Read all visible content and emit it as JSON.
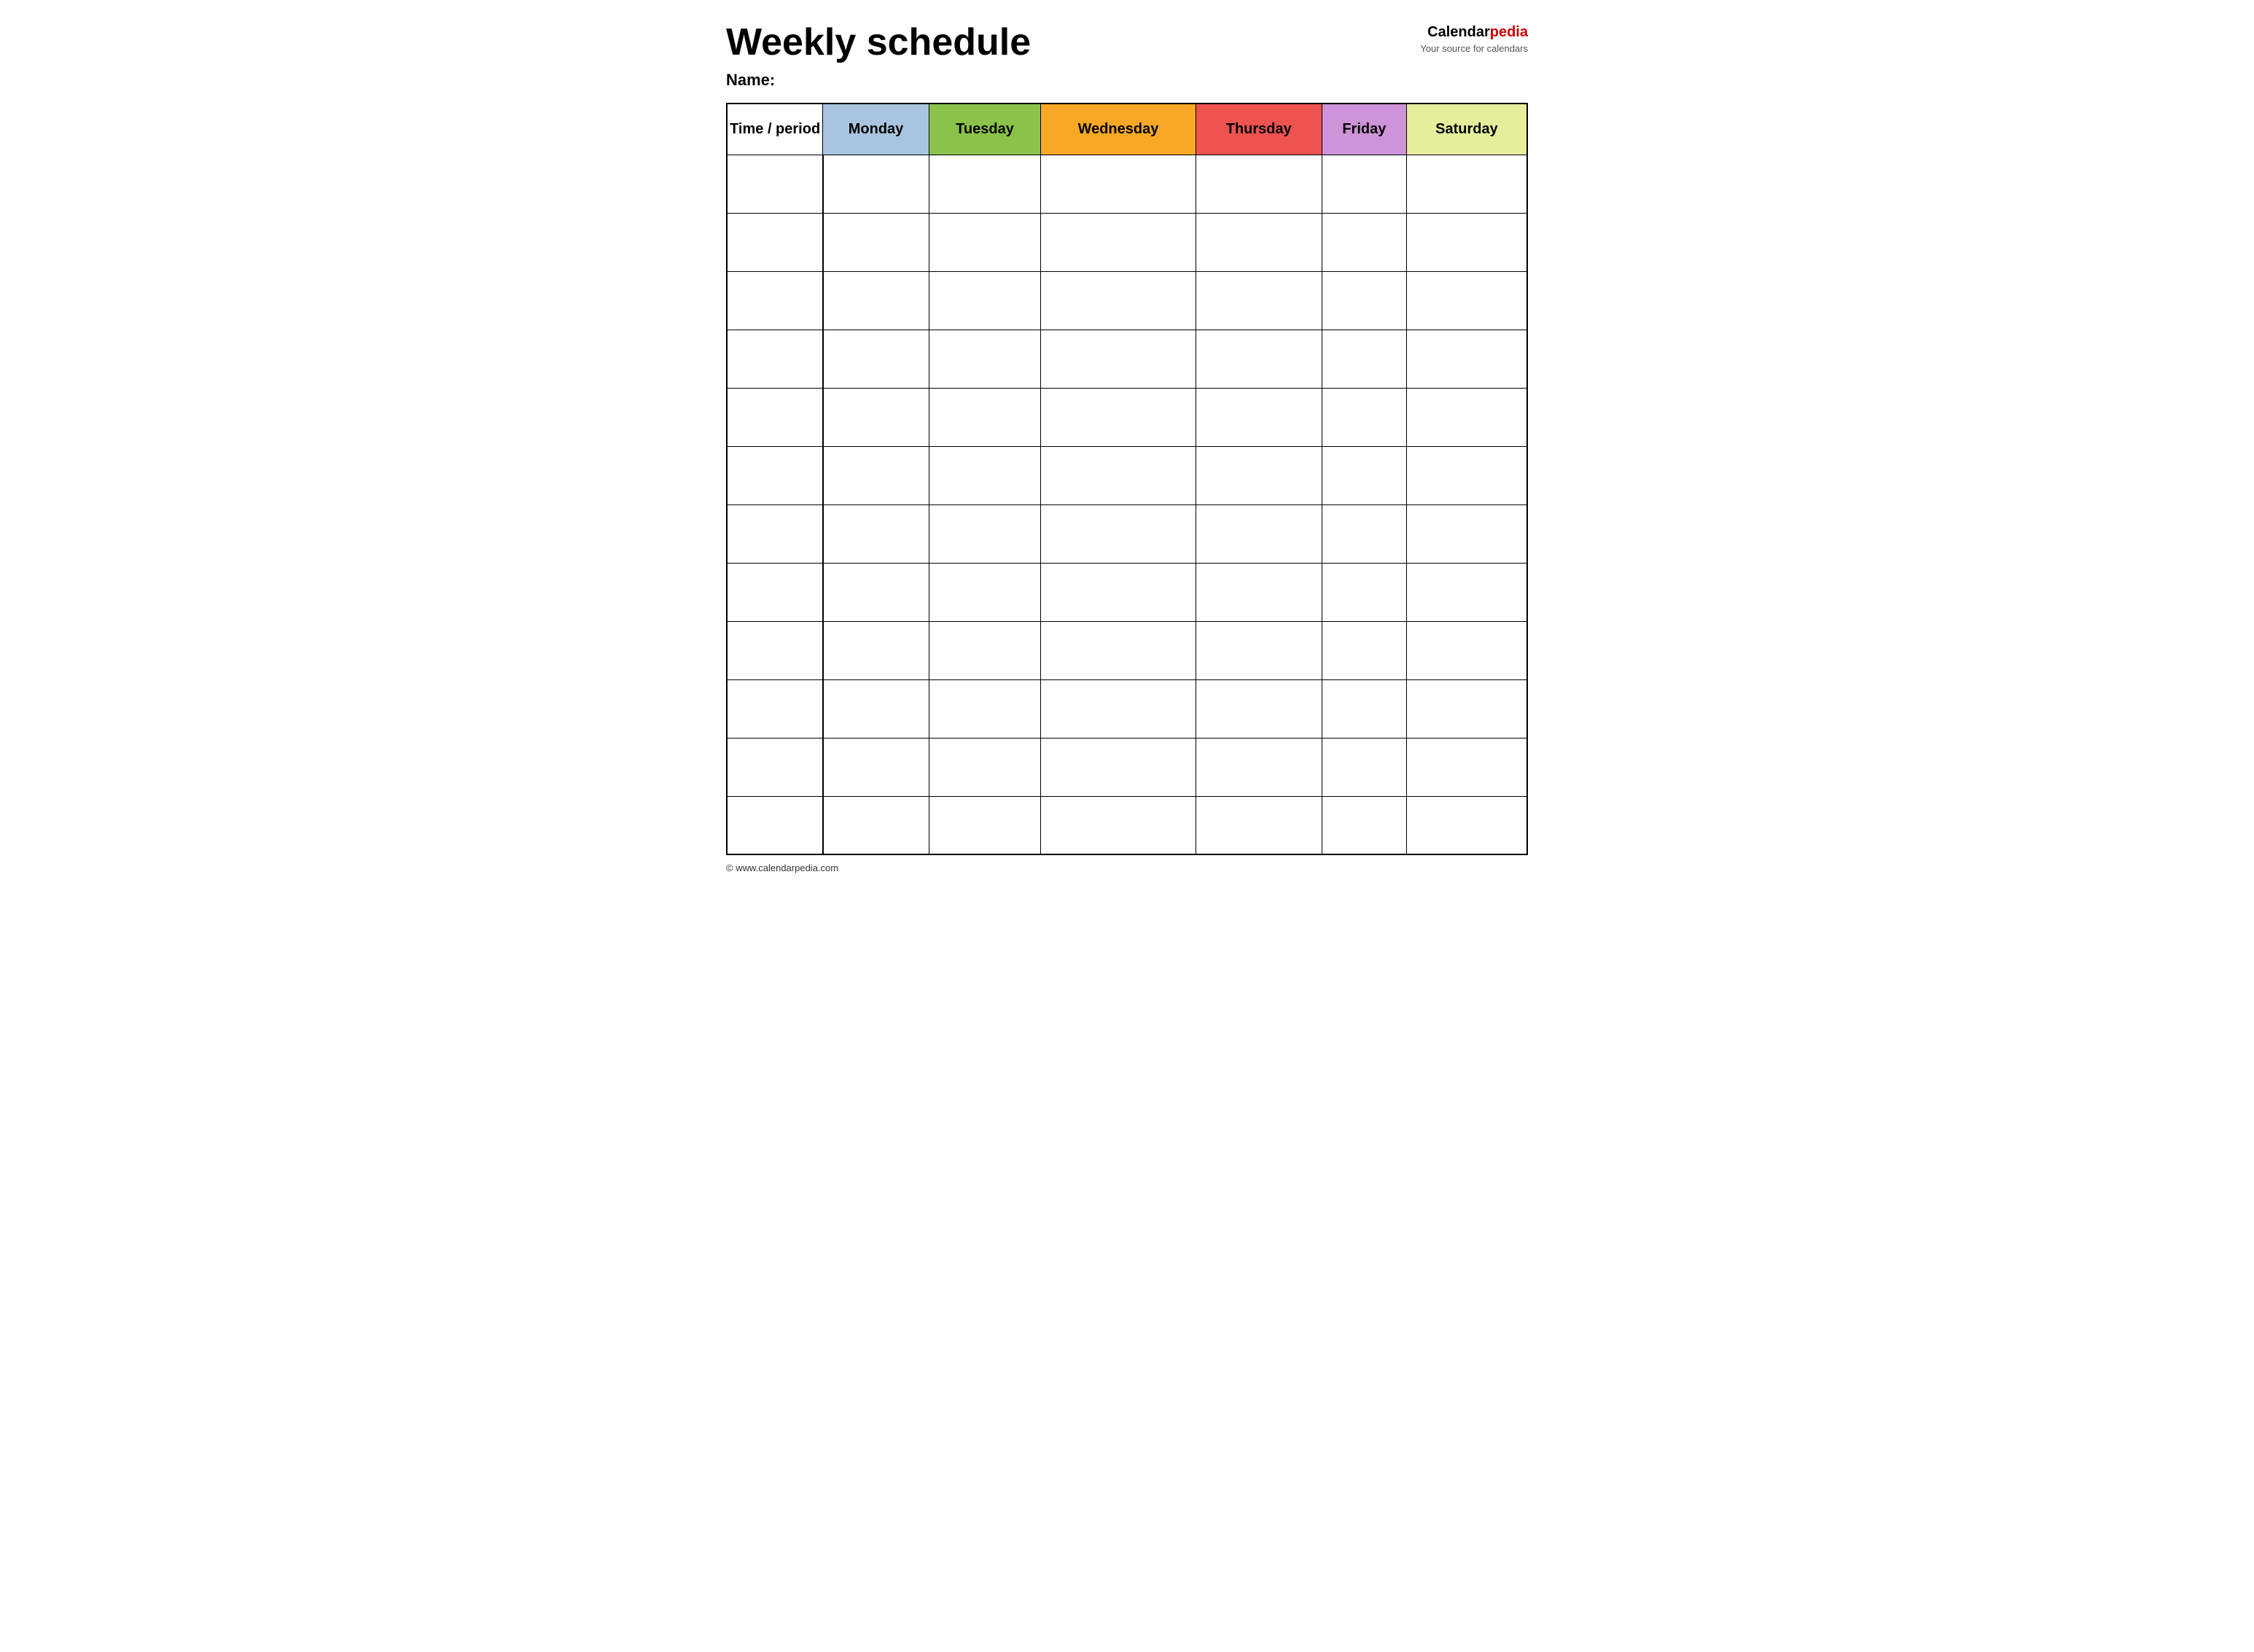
{
  "header": {
    "title": "Weekly schedule",
    "brand": {
      "calendar": "Calendar",
      "pedia": "pedia",
      "tagline": "Your source for calendars"
    },
    "name_label": "Name:"
  },
  "table": {
    "columns": [
      {
        "id": "time",
        "label": "Time / period",
        "color": "#ffffff"
      },
      {
        "id": "monday",
        "label": "Monday",
        "color": "#a8c4e0"
      },
      {
        "id": "tuesday",
        "label": "Tuesday",
        "color": "#8bc34a"
      },
      {
        "id": "wednesday",
        "label": "Wednesday",
        "color": "#f9a825"
      },
      {
        "id": "thursday",
        "label": "Thursday",
        "color": "#ef5350"
      },
      {
        "id": "friday",
        "label": "Friday",
        "color": "#ce93d8"
      },
      {
        "id": "saturday",
        "label": "Saturday",
        "color": "#e6ee9c"
      }
    ],
    "rows": 12
  },
  "footer": {
    "url": "© www.calendarpedia.com"
  }
}
